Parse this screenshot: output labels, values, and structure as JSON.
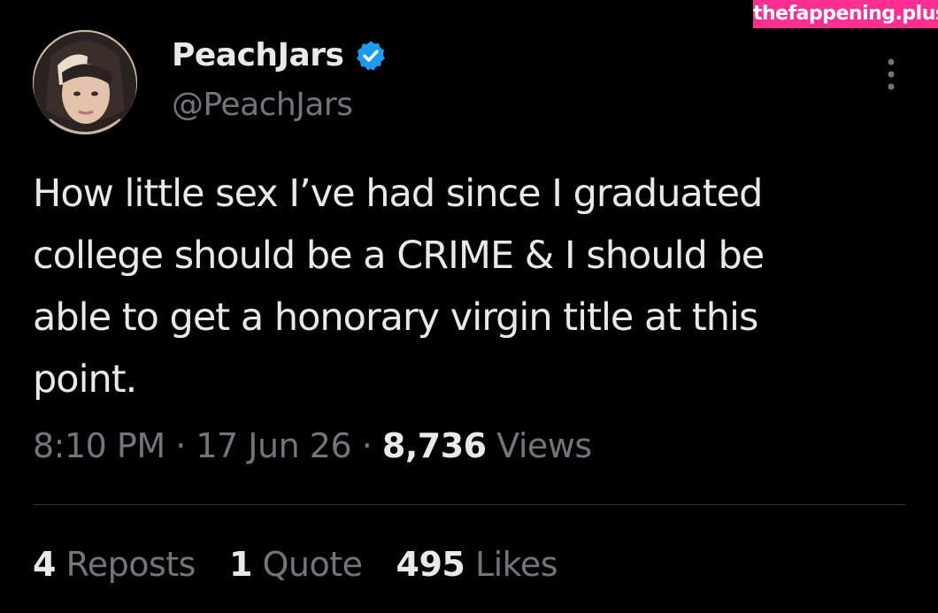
{
  "watermark": "thefappening.plus",
  "author": {
    "display_name": "PeachJars",
    "handle": "@PeachJars",
    "verified_icon": "verified-badge-icon",
    "avatar": "profile-photo"
  },
  "tweet": {
    "text": "How little sex I’ve had since I graduated\ncollege should be a CRIME & I should be\nable to get a honorary virgin title at this\npoint."
  },
  "meta": {
    "time": "8:10 PM",
    "sep1": " · ",
    "date": "17 Jun 26",
    "sep2": " · ",
    "views_count": "8,736",
    "views_label": " Views"
  },
  "stats": {
    "reposts_count": "4",
    "reposts_label": " Reposts",
    "quotes_count": "1",
    "quotes_label": " Quote",
    "likes_count": "495",
    "likes_label": " Likes"
  },
  "colors": {
    "background": "#000000",
    "primary_text": "#e7e9ea",
    "secondary_text": "#71767b",
    "verified_blue": "#1d9bf0",
    "watermark_bg": "#ff2f92"
  }
}
